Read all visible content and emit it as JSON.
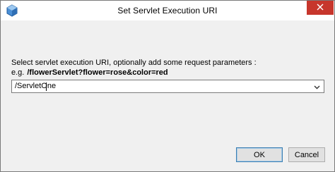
{
  "window": {
    "title": "Set Servlet Execution URI"
  },
  "dialog": {
    "instruction": "Select servlet execution URI, optionally add some request parameters :",
    "example_prefix": "e.g.",
    "example_value": "/flowerServlet?flower=rose&color=red",
    "uri_combo": {
      "value": "/ServletOne"
    }
  },
  "buttons": {
    "ok_label": "OK",
    "cancel_label": "Cancel"
  },
  "icons": {
    "app": "app-icon",
    "close": "close-icon",
    "dropdown": "chevron-down-icon"
  },
  "colors": {
    "close_button": "#c7362c",
    "default_button_border": "#3c7fb1",
    "dialog_background": "#f0f0f0"
  }
}
